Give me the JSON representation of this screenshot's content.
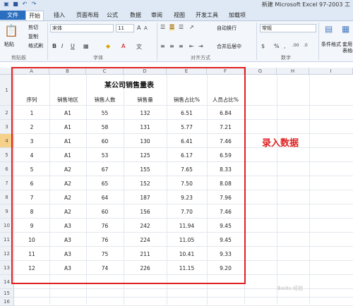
{
  "window": {
    "title": "新建 Microsoft Excel 97-2003 工"
  },
  "tabs": [
    "文件",
    "开始",
    "插入",
    "页面布局",
    "公式",
    "数据",
    "审阅",
    "视图",
    "开发工具",
    "加载项"
  ],
  "ribbon": {
    "clipboard": {
      "paste": "粘贴",
      "cut": "剪切",
      "copy": "复制",
      "format_painter": "格式刷",
      "label": "剪贴板"
    },
    "font": {
      "name": "宋体",
      "size": "11",
      "label": "字体"
    },
    "alignment": {
      "wrap": "自动换行",
      "merge": "合并后居中",
      "label": "对齐方式"
    },
    "number": {
      "format": "常规",
      "label": "数字"
    },
    "styles": {
      "conditional": "条件格式",
      "table": "套用",
      "table2": "表格格"
    }
  },
  "columns": [
    "A",
    "B",
    "C",
    "D",
    "E",
    "F",
    "G",
    "H",
    "I"
  ],
  "rows": [
    "1",
    "2",
    "3",
    "4",
    "5",
    "6",
    "7",
    "8",
    "9",
    "10",
    "11",
    "12",
    "13",
    "14",
    "15",
    "16"
  ],
  "sheet": {
    "title": "某公司销售量表",
    "headers": [
      "序列",
      "销售地区",
      "销售人数",
      "销售量",
      "销售占比%",
      "人员占比%"
    ],
    "data": [
      [
        "1",
        "A1",
        "55",
        "132",
        "6.51",
        "6.84"
      ],
      [
        "2",
        "A1",
        "58",
        "131",
        "5.77",
        "7.21"
      ],
      [
        "3",
        "A1",
        "60",
        "130",
        "6.41",
        "7.46"
      ],
      [
        "4",
        "A1",
        "53",
        "125",
        "6.17",
        "6.59"
      ],
      [
        "5",
        "A2",
        "67",
        "155",
        "7.65",
        "8.33"
      ],
      [
        "6",
        "A2",
        "65",
        "152",
        "7.50",
        "8.08"
      ],
      [
        "7",
        "A2",
        "64",
        "187",
        "9.23",
        "7.96"
      ],
      [
        "8",
        "A2",
        "60",
        "156",
        "7.70",
        "7.46"
      ],
      [
        "9",
        "A3",
        "76",
        "242",
        "11.94",
        "9.45"
      ],
      [
        "10",
        "A3",
        "76",
        "224",
        "11.05",
        "9.45"
      ],
      [
        "11",
        "A3",
        "75",
        "211",
        "10.41",
        "9.33"
      ],
      [
        "12",
        "A3",
        "74",
        "226",
        "11.15",
        "9.20"
      ]
    ]
  },
  "annotation": "录入数据",
  "watermark": "Baidu 经验"
}
